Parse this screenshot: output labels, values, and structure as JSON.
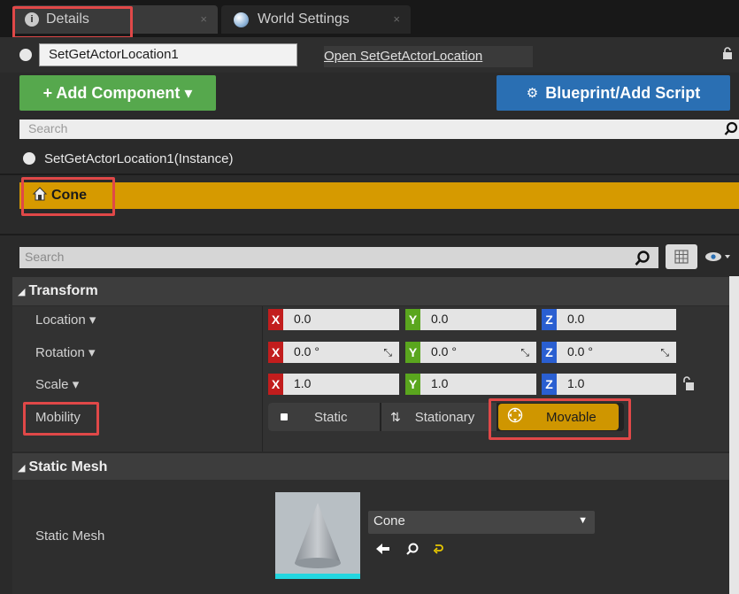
{
  "tabs": [
    {
      "label": "Details"
    },
    {
      "label": "World Settings"
    }
  ],
  "tab_close_glyph": "×",
  "actor": {
    "name_value": "SetGetActorLocation1",
    "open_link": "Open SetGetActorLocation"
  },
  "buttons": {
    "add_component": "+ Add Component ▾",
    "blueprint": "Blueprint/Add Script"
  },
  "component_search": {
    "placeholder": "Search"
  },
  "components": {
    "instance": "SetGetActorLocation1(Instance)",
    "selected": "Cone"
  },
  "details_search": {
    "placeholder": "Search"
  },
  "transform": {
    "header": "Transform",
    "location": {
      "label": "Location ▾",
      "x": "0.0",
      "y": "0.0",
      "z": "0.0"
    },
    "rotation": {
      "label": "Rotation ▾",
      "x": "0.0 °",
      "y": "0.0 °",
      "z": "0.0 °"
    },
    "scale": {
      "label": "Scale ▾",
      "x": "1.0",
      "y": "1.0",
      "z": "1.0"
    },
    "mobility": {
      "label": "Mobility",
      "options": [
        "Static",
        "Stationary",
        "Movable"
      ],
      "selected": "Movable"
    }
  },
  "axis_labels": {
    "x": "X",
    "y": "Y",
    "z": "Z"
  },
  "static_mesh": {
    "header": "Static Mesh",
    "label": "Static Mesh",
    "value": "Cone"
  },
  "colors": {
    "selection": "#d69a00",
    "add_button": "#56a84d",
    "blueprint_button": "#2a6fb3",
    "highlight_box": "#e04848"
  }
}
